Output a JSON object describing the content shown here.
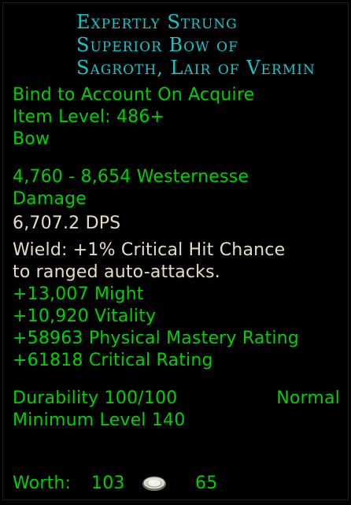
{
  "item": {
    "name_lines": [
      "Expertly Strung",
      "Superior Bow of",
      "Sagroth, Lair of Vermin"
    ],
    "binding": "Bind to Account On Acquire",
    "item_level": "Item Level: 486+",
    "type": "Bow",
    "damage_line1": "4,760 - 8,654 Westernesse",
    "damage_line2": "Damage",
    "dps": "6,707.2 DPS",
    "wield_line1": "Wield: +1% Critical Hit Chance",
    "wield_line2": "to ranged auto-attacks.",
    "stats": [
      "+13,007 Might",
      "+10,920 Vitality",
      "+58963 Physical Mastery Rating",
      "+61818 Critical Rating"
    ],
    "durability": "Durability 100/100",
    "durability_type": "Normal",
    "minimum_level": "Minimum Level 140",
    "worth_label": "Worth:",
    "worth_gold": "103",
    "worth_copper": "65"
  },
  "colors": {
    "name": "#19c5c9",
    "green": "#00d000",
    "light_green": "#20f020",
    "tan": "#e4dcc4",
    "background": "#000000"
  },
  "icons": {
    "currency": "silver-coin-icon"
  }
}
